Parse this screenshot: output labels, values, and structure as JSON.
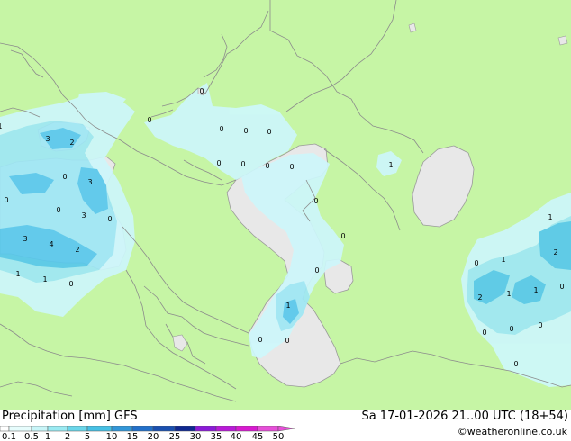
{
  "header": {
    "title": "Precipitation [mm]  GFS",
    "datetime": "Sa 17-01-2026 21..00 UTC (18+54)",
    "credit": "©weatheronline.co.uk"
  },
  "legend": {
    "ticks": [
      "0.1",
      "0.5",
      "1",
      "2",
      "5",
      "10",
      "15",
      "20",
      "25",
      "30",
      "35",
      "40",
      "45",
      "50"
    ],
    "colors": [
      "#ffffff",
      "#e6fcfc",
      "#c8f5f8",
      "#9aeaf2",
      "#6ad6ea",
      "#46c0e4",
      "#3296d8",
      "#2270ca",
      "#1a50b0",
      "#0f2890",
      "#8b1ad8",
      "#b91ad8",
      "#d81ad0",
      "#e64fd8"
    ]
  },
  "map_values": [
    {
      "v": "3"
    },
    {
      "v": "2"
    },
    {
      "v": "1"
    },
    {
      "v": "0"
    },
    {
      "v": "3"
    },
    {
      "v": "0"
    },
    {
      "v": "3"
    },
    {
      "v": "0"
    },
    {
      "v": "3"
    },
    {
      "v": "4"
    },
    {
      "v": "2"
    },
    {
      "v": "1"
    },
    {
      "v": "1"
    },
    {
      "v": "0"
    },
    {
      "v": "0"
    },
    {
      "v": "0"
    },
    {
      "v": "0"
    },
    {
      "v": "0"
    },
    {
      "v": "0"
    },
    {
      "v": "0"
    },
    {
      "v": "0"
    },
    {
      "v": "0"
    },
    {
      "v": "0"
    },
    {
      "v": "0"
    },
    {
      "v": "0"
    },
    {
      "v": "0"
    },
    {
      "v": "0"
    },
    {
      "v": "1"
    },
    {
      "v": "0"
    },
    {
      "v": "0"
    },
    {
      "v": "0"
    },
    {
      "v": "1"
    },
    {
      "v": "1"
    },
    {
      "v": "2"
    },
    {
      "v": "2"
    },
    {
      "v": "1"
    },
    {
      "v": "1"
    },
    {
      "v": "1"
    },
    {
      "v": "0"
    },
    {
      "v": "0"
    },
    {
      "v": "0"
    },
    {
      "v": "0"
    },
    {
      "v": "0"
    }
  ],
  "colors": {
    "land": "#c6f5a5",
    "sea": "#e8e8e8",
    "precip_light": "#cdf7fb",
    "precip_mid": "#9fe7f5",
    "precip_heavy": "#58c8ec"
  }
}
